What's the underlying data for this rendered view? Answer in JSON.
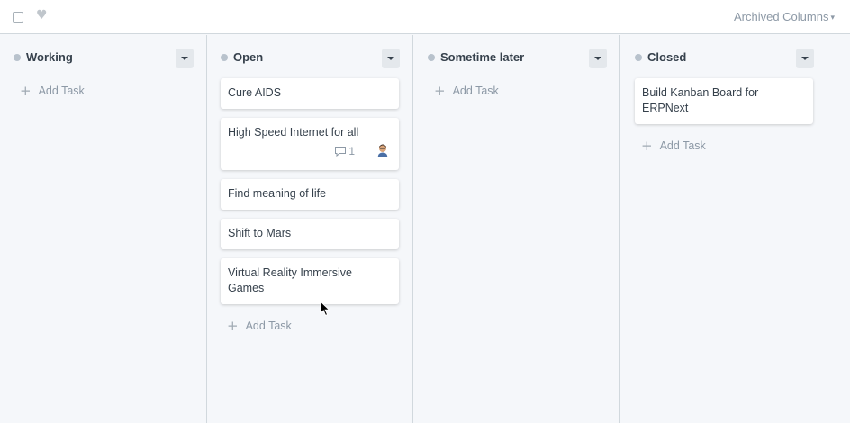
{
  "toolbar": {
    "select_all": "checkbox",
    "liked": "heart-icon",
    "archived_label": "Archived Columns",
    "archived_caret": "▾"
  },
  "columns": [
    {
      "title": "Working",
      "cards": [],
      "add_label": "Add Task"
    },
    {
      "title": "Open",
      "cards": [
        {
          "title": "Cure AIDS"
        },
        {
          "title": "High Speed Internet for all",
          "comments": "1",
          "has_avatar": true
        },
        {
          "title": "Find meaning of life"
        },
        {
          "title": "Shift to Mars"
        },
        {
          "title": "Virtual Reality Immersive Games"
        }
      ],
      "add_label": "Add Task"
    },
    {
      "title": "Sometime later",
      "cards": [],
      "add_label": "Add Task"
    },
    {
      "title": "Closed",
      "cards": [
        {
          "title": "Build Kanban Board for ERPNext"
        }
      ],
      "add_label": "Add Task"
    }
  ],
  "colors": {
    "dot": "#b8c2cc",
    "border": "#d1d8dd",
    "muted": "#8d99a6",
    "text": "#36414c"
  }
}
